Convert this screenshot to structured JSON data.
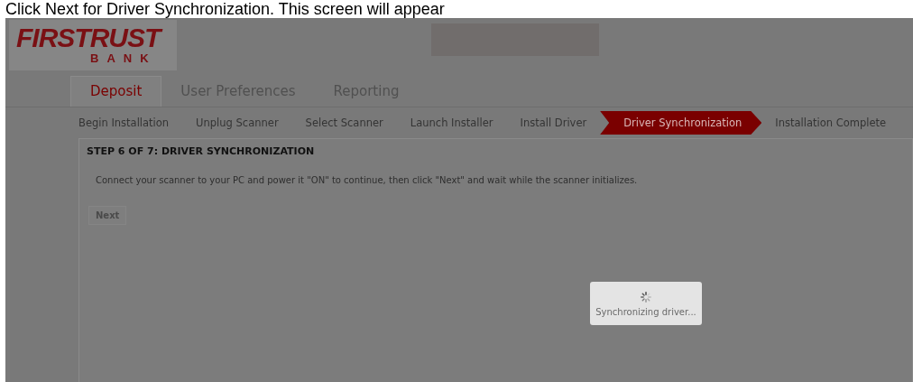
{
  "caption": "Click Next for Driver Synchronization. This screen will appear",
  "logo": {
    "name": "FIRSTRUST",
    "subtitle": "BANK"
  },
  "tabs": [
    {
      "label": "Deposit",
      "selected": true
    },
    {
      "label": "User Preferences",
      "selected": false
    },
    {
      "label": "Reporting",
      "selected": false
    }
  ],
  "steps": [
    {
      "label": "Begin Installation",
      "selected": false
    },
    {
      "label": "Unplug Scanner",
      "selected": false
    },
    {
      "label": "Select Scanner",
      "selected": false
    },
    {
      "label": "Launch Installer",
      "selected": false
    },
    {
      "label": "Install Driver",
      "selected": false
    },
    {
      "label": "Driver Synchronization",
      "selected": true
    },
    {
      "label": "Installation Complete",
      "selected": false
    }
  ],
  "step_title": "STEP 6 OF 7: DRIVER SYNCHRONIZATION",
  "instructions": "Connect your scanner to your PC and power it \"ON\" to continue, then click \"Next\" and wait while the scanner initializes.",
  "next_button": {
    "label": "Next",
    "disabled": true
  },
  "loading": {
    "message": "Synchronizing driver..."
  }
}
